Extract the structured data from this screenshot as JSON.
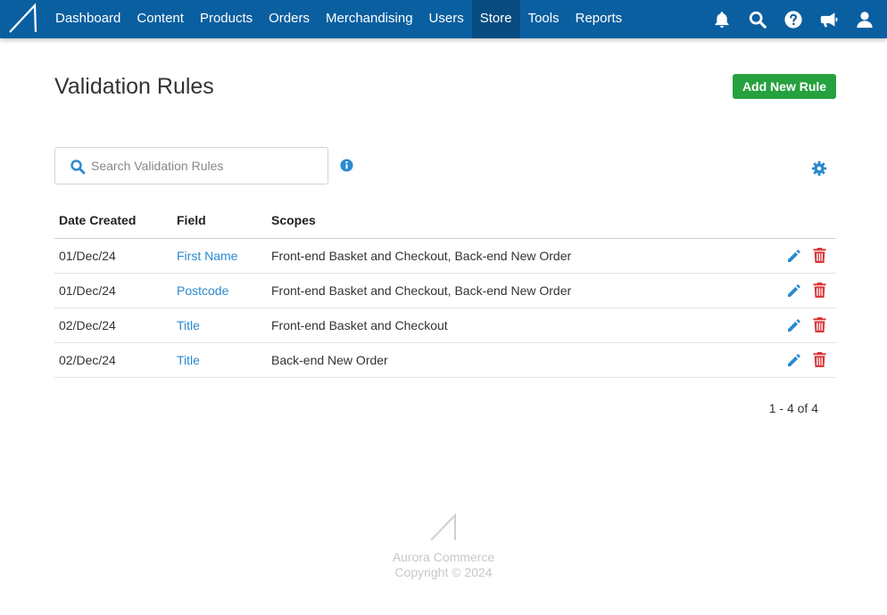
{
  "topbar": {
    "nav": [
      {
        "label": "Dashboard",
        "active": false
      },
      {
        "label": "Content",
        "active": false
      },
      {
        "label": "Products",
        "active": false
      },
      {
        "label": "Orders",
        "active": false
      },
      {
        "label": "Merchandising",
        "active": false
      },
      {
        "label": "Users",
        "active": false
      },
      {
        "label": "Store",
        "active": true
      },
      {
        "label": "Tools",
        "active": false
      },
      {
        "label": "Reports",
        "active": false
      }
    ],
    "icons": [
      "bell-icon",
      "search-icon",
      "help-icon",
      "megaphone-icon",
      "user-icon"
    ],
    "background": "#0a5fa0",
    "active_background": "#074b80"
  },
  "page": {
    "title": "Validation Rules",
    "add_button_label": "Add New Rule",
    "add_button_color": "#26a13f"
  },
  "search": {
    "placeholder": "Search Validation Rules",
    "value": ""
  },
  "table": {
    "headers": {
      "date": "Date Created",
      "field": "Field",
      "scopes": "Scopes"
    },
    "rows": [
      {
        "date": "01/Dec/24",
        "field": "First Name",
        "scopes": "Front-end Basket and Checkout, Back-end New Order"
      },
      {
        "date": "01/Dec/24",
        "field": "Postcode",
        "scopes": "Front-end Basket and Checkout, Back-end New Order"
      },
      {
        "date": "02/Dec/24",
        "field": "Title",
        "scopes": "Front-end Basket and Checkout"
      },
      {
        "date": "02/Dec/24",
        "field": "Title",
        "scopes": "Back-end New Order"
      }
    ],
    "link_color": "#2a8ad0",
    "delete_color": "#d9383a"
  },
  "pagination": {
    "text": "1 - 4 of 4"
  },
  "footer": {
    "brand": "Aurora Commerce",
    "copyright": "Copyright © 2024"
  }
}
